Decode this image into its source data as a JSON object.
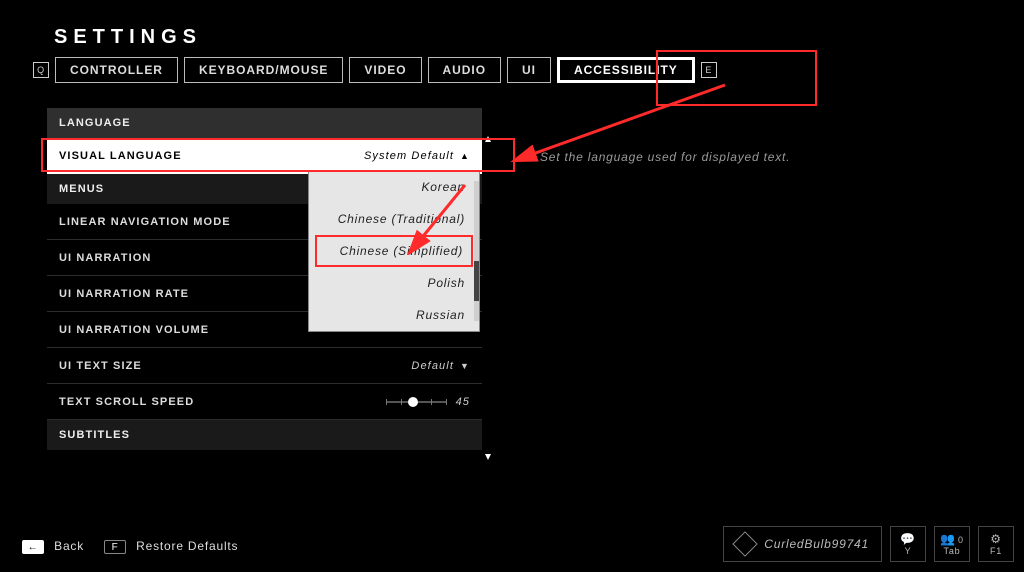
{
  "title": "SETTINGS",
  "nav_keys": {
    "prev": "Q",
    "next": "E"
  },
  "tabs": [
    {
      "label": "CONTROLLER",
      "active": false
    },
    {
      "label": "KEYBOARD/MOUSE",
      "active": false
    },
    {
      "label": "VIDEO",
      "active": false
    },
    {
      "label": "AUDIO",
      "active": false
    },
    {
      "label": "UI",
      "active": false
    },
    {
      "label": "ACCESSIBILITY",
      "active": true
    }
  ],
  "groups": {
    "language": "LANGUAGE",
    "menus": "MENUS",
    "subtitles": "SUBTITLES"
  },
  "rows": {
    "visual_language": {
      "label": "VISUAL LANGUAGE",
      "value": "System Default"
    },
    "linear_navigation": {
      "label": "LINEAR NAVIGATION MODE"
    },
    "ui_narration": {
      "label": "UI NARRATION"
    },
    "ui_narration_rate": {
      "label": "UI NARRATION RATE"
    },
    "ui_narration_volume": {
      "label": "UI NARRATION VOLUME"
    },
    "ui_text_size": {
      "label": "UI TEXT SIZE",
      "value": "Default"
    },
    "text_scroll_speed": {
      "label": "TEXT SCROLL SPEED",
      "value": "45",
      "percent": 45
    }
  },
  "dropdown_options": [
    "Korean",
    "Chinese (Traditional)",
    "Chinese (Simplified)",
    "Polish",
    "Russian"
  ],
  "dropdown_highlight_index": 2,
  "help_text": "Set the language used for displayed text.",
  "footer": {
    "back": "Back",
    "restore": "Restore Defaults",
    "back_key": "←",
    "restore_key": "F",
    "username": "CurledBulb99741",
    "party_count": "0",
    "keys": {
      "chat": "Y",
      "social": "Tab",
      "opts": "F1"
    }
  }
}
